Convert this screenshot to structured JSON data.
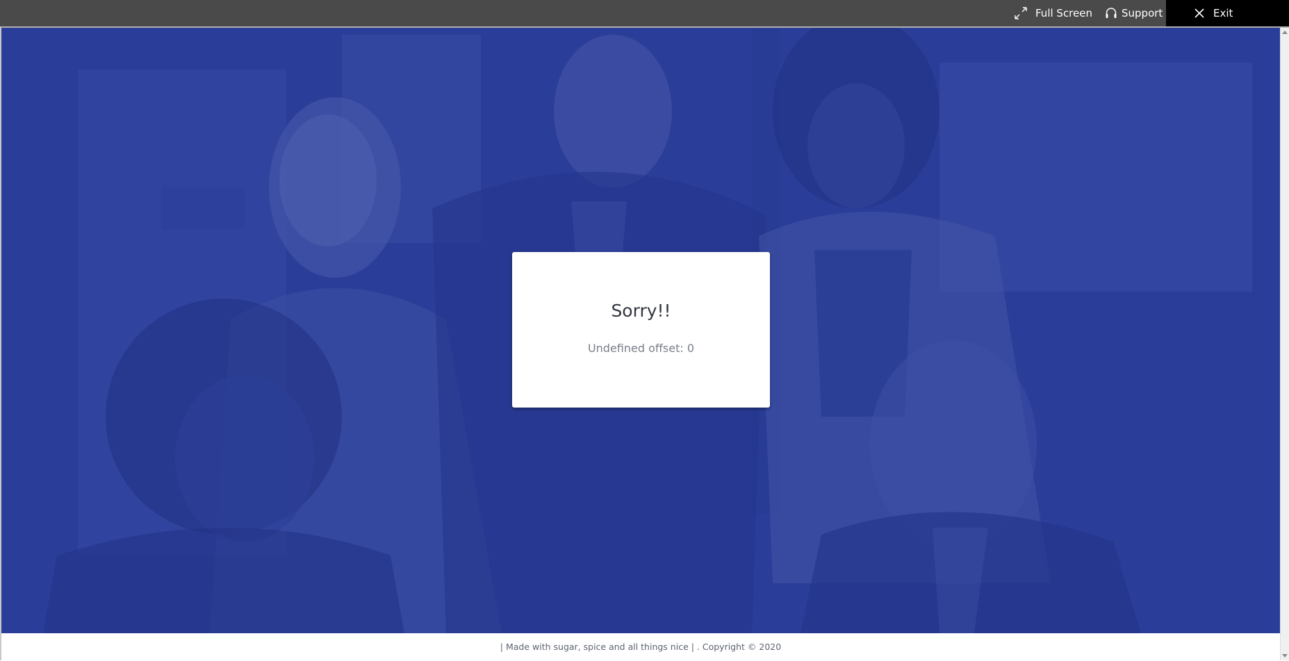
{
  "topbar": {
    "fullscreen_label": "Full Screen",
    "support_label": "Support",
    "exit_label": "Exit"
  },
  "modal": {
    "title": "Sorry!!",
    "message": "Undefined offset: 0"
  },
  "footer": {
    "text": "| Made with sugar, spice and all things nice | . Copyright © 2020"
  },
  "colors": {
    "topbar_bg": "#4a4a4a",
    "exit_bg": "#000000",
    "hero_overlay": "#2b3d9a",
    "modal_bg": "#ffffff",
    "footer_bg": "#ffffff"
  },
  "icons": {
    "fullscreen": "expand-arrows-icon",
    "support": "headset-icon",
    "exit": "close-icon"
  }
}
